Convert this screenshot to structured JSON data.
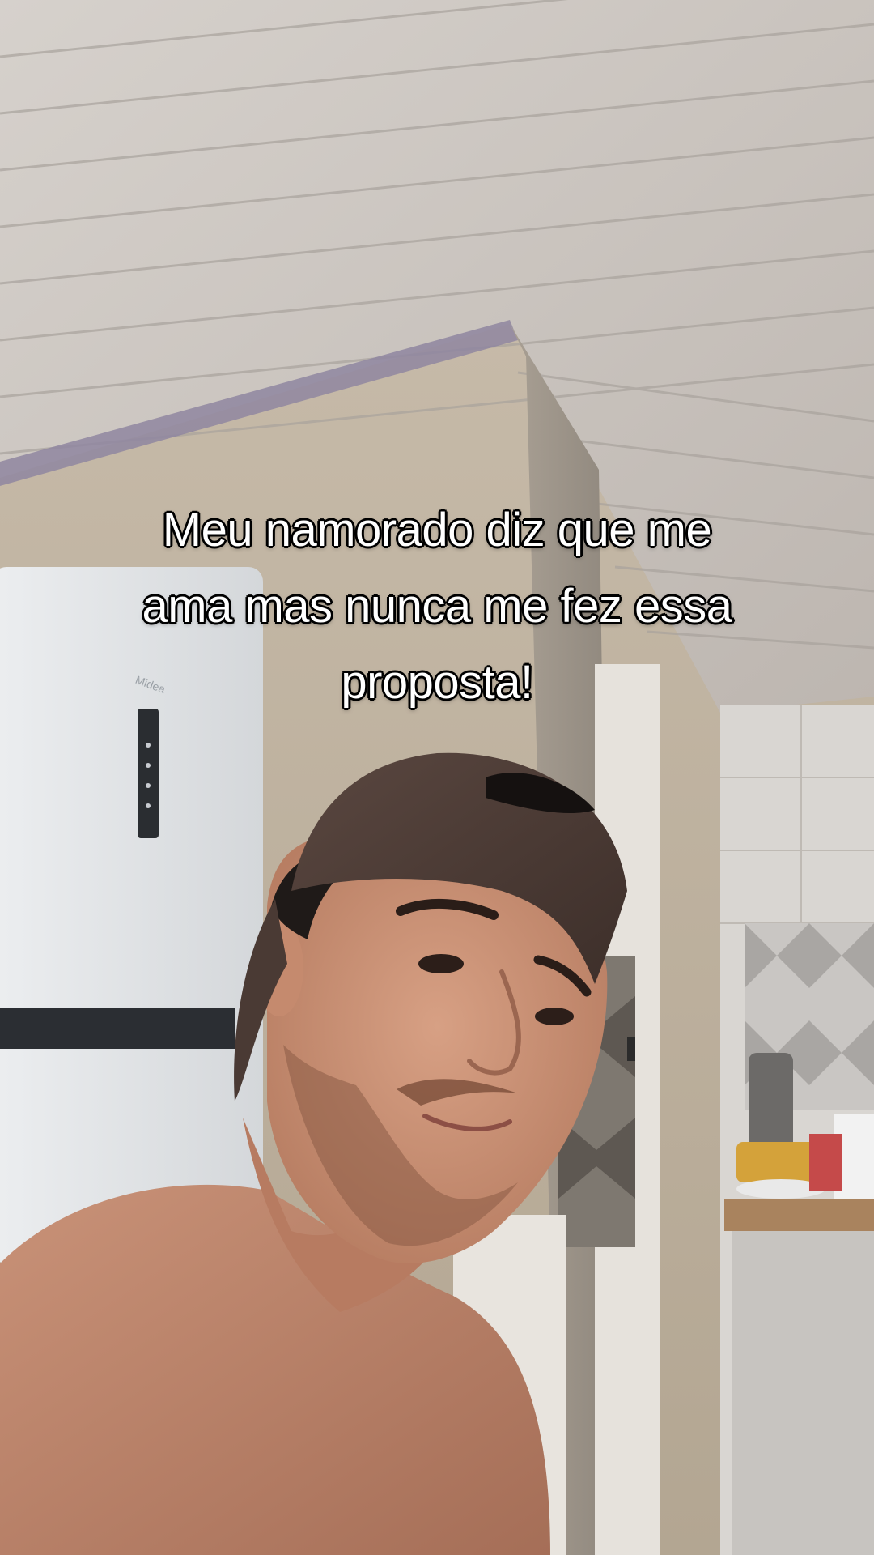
{
  "caption": {
    "lines": [
      "Meu namorado diz que me",
      "ama mas nunca me fez essa",
      "proposta!"
    ]
  },
  "photo": {
    "subject": "selfie-person-with-backwards-cap",
    "fridge_brand": "Midea"
  }
}
